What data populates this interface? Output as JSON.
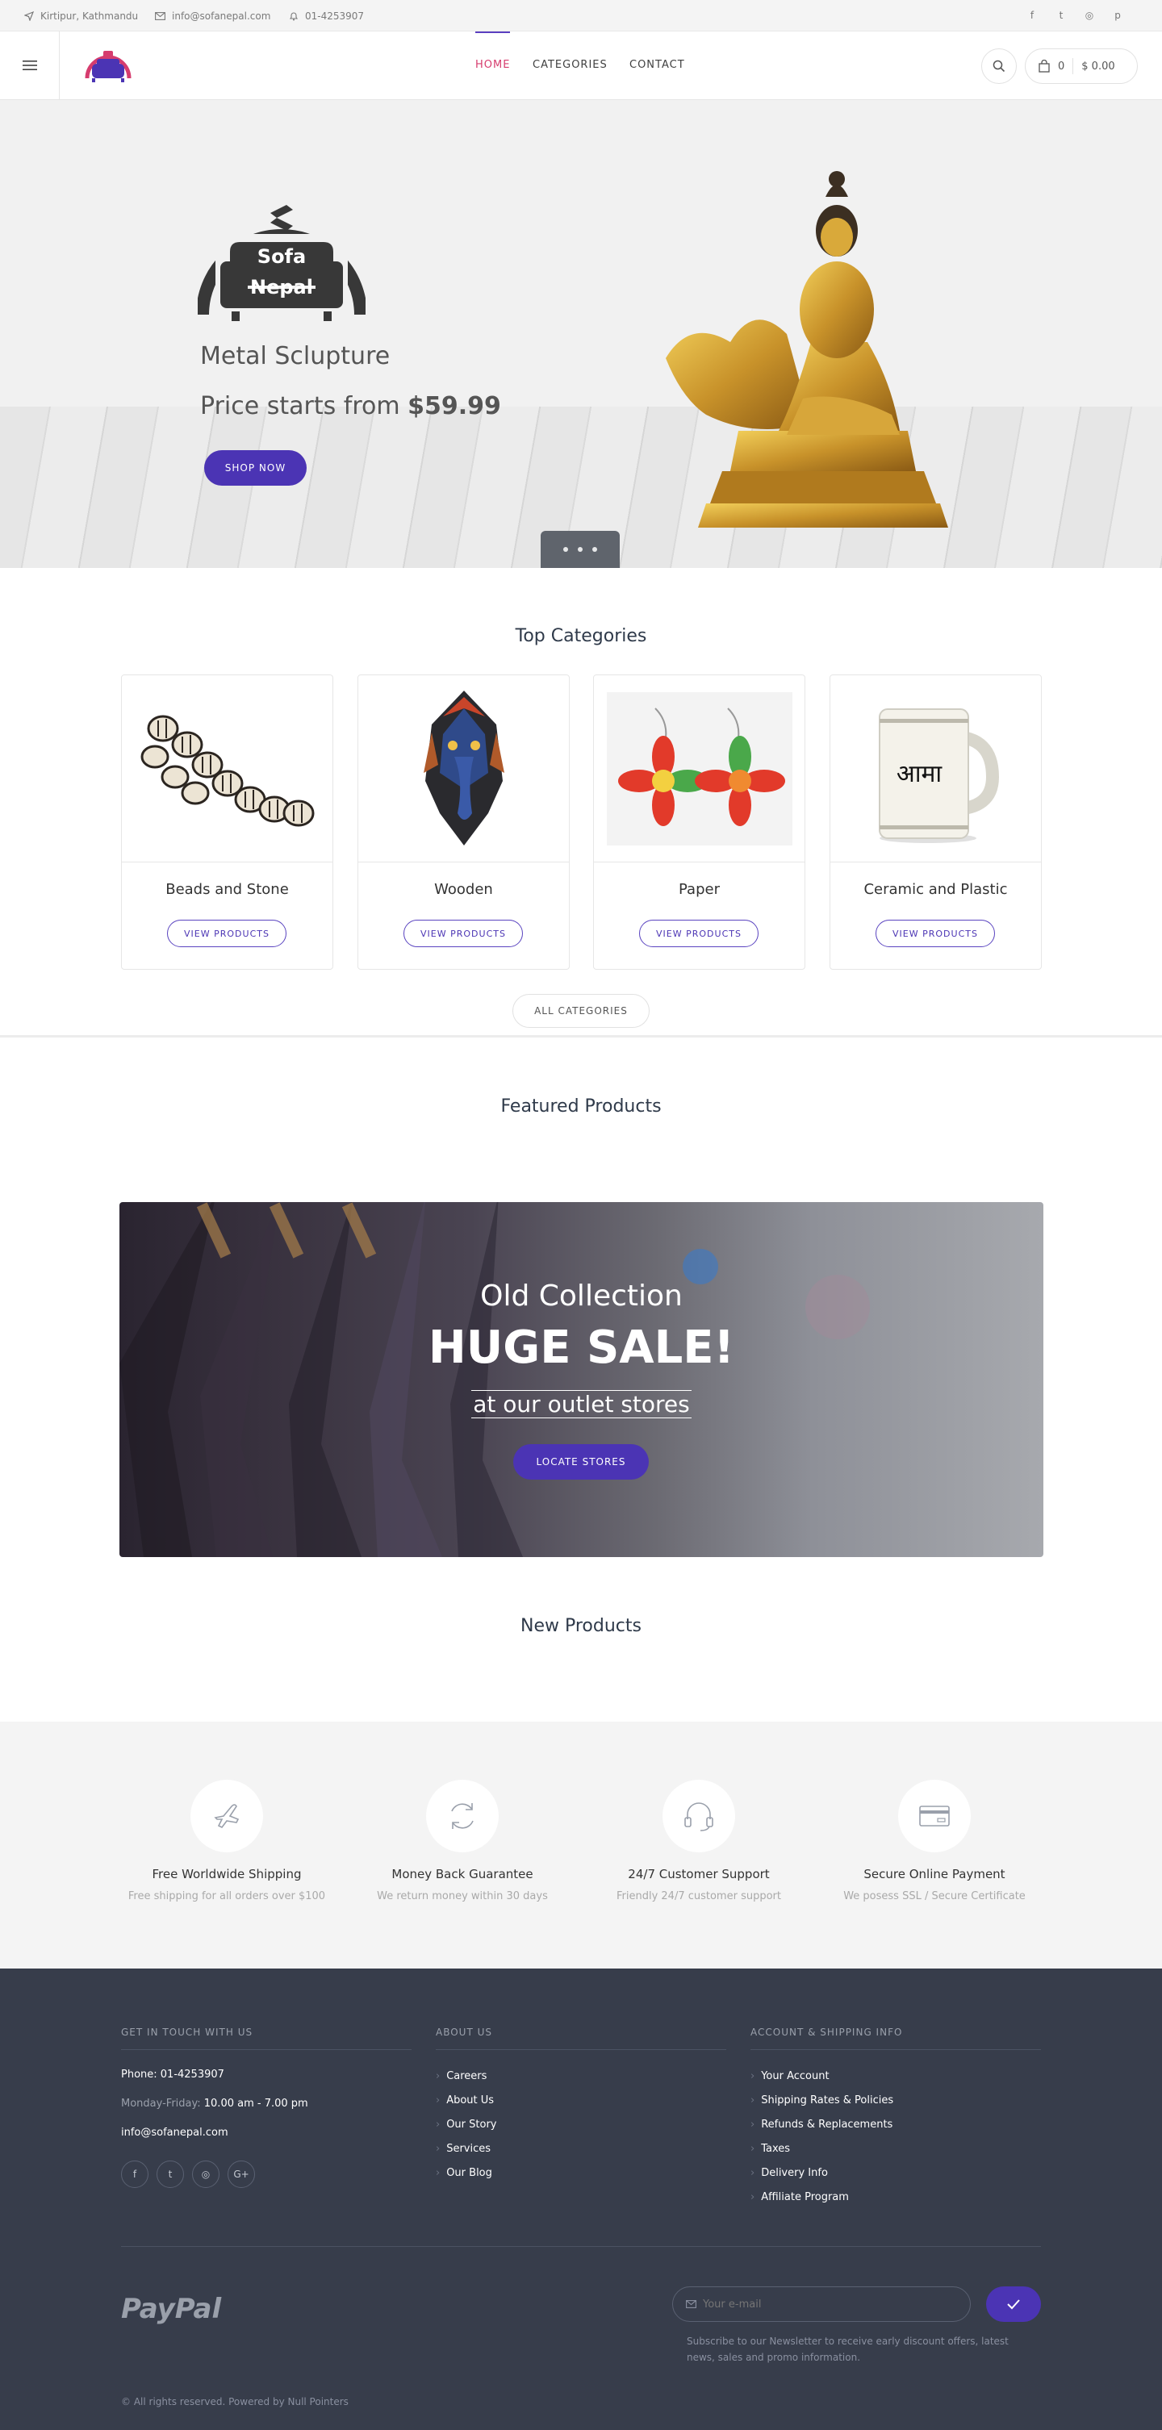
{
  "topbar": {
    "location": "Kirtipur, Kathmandu",
    "email": "info@sofanepal.com",
    "phone": "01-4253907",
    "social": [
      {
        "icon": "facebook-icon",
        "glyph": "f"
      },
      {
        "icon": "twitter-icon",
        "glyph": "t"
      },
      {
        "icon": "instagram-icon",
        "glyph": "◎"
      },
      {
        "icon": "pinterest-icon",
        "glyph": "p"
      }
    ]
  },
  "header": {
    "nav": [
      "HOME",
      "CATEGORIES",
      "CONTACT"
    ],
    "active_nav": "HOME",
    "cart_count": "0",
    "cart_total": "$ 0.00",
    "logo_line1": "Sofa",
    "logo_line2": "Nepal",
    "brand_color": "#4b34b4",
    "accent_color": "#d63c6e"
  },
  "hero": {
    "logo_line1": "Sofa",
    "logo_line2": "Nepal",
    "title": "Metal Sclupture",
    "price_prefix": "Price starts from",
    "price": "$59.99",
    "button": "SHOP NOW",
    "slides": 3
  },
  "top_categories": {
    "title": "Top Categories",
    "items": [
      {
        "name": "Beads and Stone",
        "button": "VIEW PRODUCTS"
      },
      {
        "name": "Wooden",
        "button": "VIEW PRODUCTS"
      },
      {
        "name": "Paper",
        "button": "VIEW PRODUCTS"
      },
      {
        "name": "Ceramic and Plastic",
        "button": "VIEW PRODUCTS",
        "mug_text": "आमा"
      }
    ],
    "all_button": "ALL CATEGORIES"
  },
  "featured": {
    "title": "Featured Products"
  },
  "sale_banner": {
    "line1": "Old Collection",
    "line2": "HUGE SALE!",
    "line3": "at our outlet stores",
    "button": "LOCATE STORES"
  },
  "new_products": {
    "title": "New Products"
  },
  "features": [
    {
      "icon": "plane-icon",
      "title": "Free Worldwide Shipping",
      "subtitle": "Free shipping for all orders over $100"
    },
    {
      "icon": "refresh-icon",
      "title": "Money Back Guarantee",
      "subtitle": "We return money within 30 days"
    },
    {
      "icon": "headset-icon",
      "title": "24/7 Customer Support",
      "subtitle": "Friendly 24/7 customer support"
    },
    {
      "icon": "credit-card-icon",
      "title": "Secure Online Payment",
      "subtitle": "We posess SSL / Secure Certificate"
    }
  ],
  "footer": {
    "contact_heading": "GET IN TOUCH WITH US",
    "phone": "Phone: 01-4253907",
    "hours_label": "Monday-Friday:",
    "hours": "10.00 am - 7.00 pm",
    "email": "info@sofanepal.com",
    "social": [
      {
        "icon": "facebook-icon",
        "glyph": "f"
      },
      {
        "icon": "twitter-icon",
        "glyph": "t"
      },
      {
        "icon": "instagram-icon",
        "glyph": "◎"
      },
      {
        "icon": "google-plus-icon",
        "glyph": "G+"
      }
    ],
    "about_heading": "ABOUT US",
    "about_links": [
      "Careers",
      "About Us",
      "Our Story",
      "Services",
      "Our Blog"
    ],
    "account_heading": "ACCOUNT & SHIPPING INFO",
    "account_links": [
      "Your Account",
      "Shipping Rates & Policies",
      "Refunds & Replacements",
      "Taxes",
      "Delivery Info",
      "Affiliate Program"
    ],
    "paypal": "PayPal",
    "newsletter_placeholder": "Your e-mail",
    "newsletter_text": "Subscribe to our Newsletter to receive early discount offers, latest news, sales and promo information.",
    "copyright": "© All rights reserved. Powered by Null Pointers"
  }
}
